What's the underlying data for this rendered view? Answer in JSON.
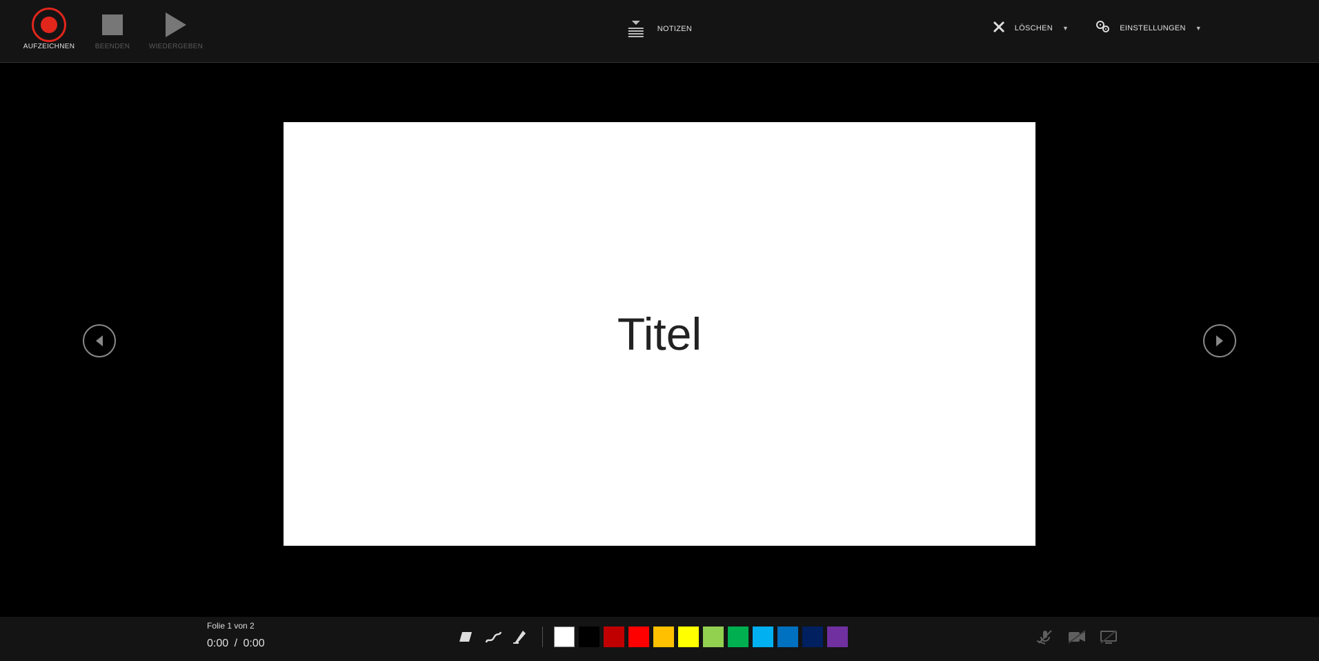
{
  "window": {
    "minimize_name": "minimize",
    "maximize_name": "maximize",
    "close_name": "close"
  },
  "toolbar": {
    "record_label": "Aufzeichnen",
    "stop_label": "Beenden",
    "play_label": "Wiedergeben",
    "notes_label": "Notizen",
    "clear_label": "Löschen",
    "settings_label": "Einstellungen"
  },
  "slide": {
    "title_text": "Titel"
  },
  "status": {
    "slide_counter": "Folie 1 von 2",
    "time_current": "0:00",
    "time_total": "0:00"
  },
  "colors": {
    "white": "#ffffff",
    "black": "#000000",
    "darkred": "#c00000",
    "red": "#ff0000",
    "orange": "#ffc000",
    "yellow": "#ffff00",
    "lightgreen": "#92d050",
    "green": "#00b050",
    "lightblue": "#00b0f0",
    "blue": "#0070c0",
    "darkblue": "#002060",
    "purple": "#7030a0"
  }
}
